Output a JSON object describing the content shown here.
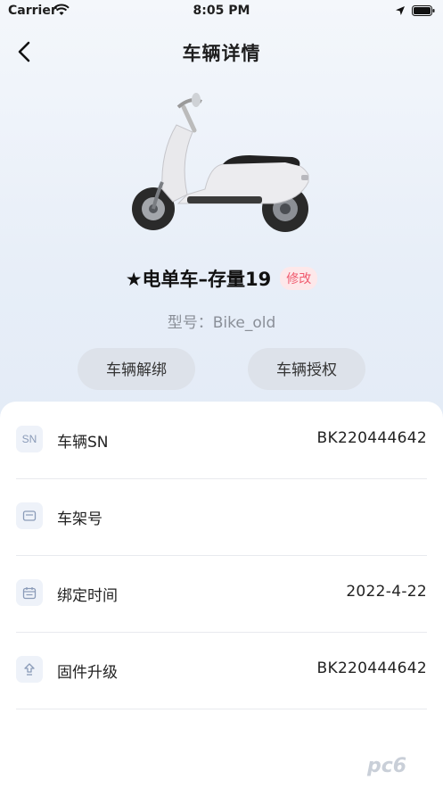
{
  "status_bar": {
    "carrier": "Carrier",
    "time": "8:05 PM"
  },
  "header": {
    "title": "车辆详情",
    "back_icon": "chevron-left-icon"
  },
  "vehicle": {
    "name": "★电单车–存量19",
    "edit_label": "修改",
    "model_text": "型号：Bike_old"
  },
  "actions": {
    "unbind_label": "车辆解绑",
    "authorize_label": "车辆授权"
  },
  "info_rows": [
    {
      "icon": "sn-icon",
      "icon_text": "SN",
      "label": "车辆SN",
      "value": "BK220444642"
    },
    {
      "icon": "frame-icon",
      "label": "车架号",
      "value": ""
    },
    {
      "icon": "calendar-icon",
      "label": "绑定时间",
      "value": "2022-4-22"
    },
    {
      "icon": "upgrade-icon",
      "label": "固件升级",
      "value": "BK220444642"
    }
  ],
  "watermark": "pc6",
  "colors": {
    "accent_red": "#f05a6e",
    "badge_bg": "#fde8ea",
    "pill_bg": "#dde2ea"
  }
}
